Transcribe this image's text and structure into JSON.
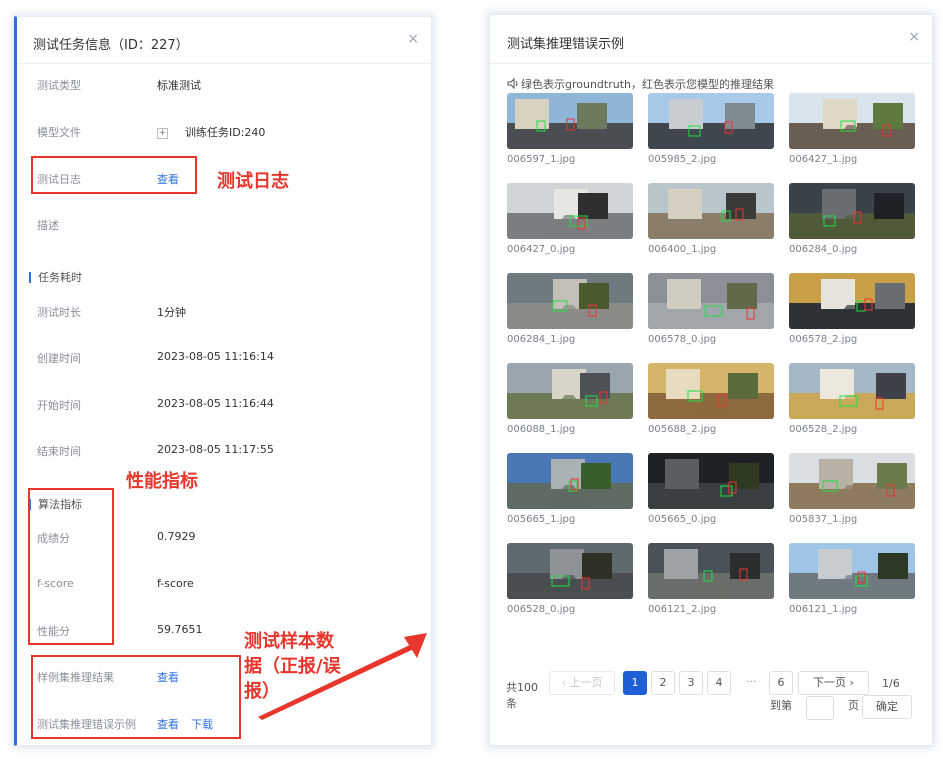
{
  "left_panel": {
    "title": "测试任务信息（ID：227）",
    "close_icon": "×",
    "rows": {
      "test_type": {
        "label": "测试类型",
        "value": "标准测试"
      },
      "model_file": {
        "label": "模型文件",
        "value": "训练任务ID:240"
      },
      "test_log": {
        "label": "测试日志",
        "link": "查看"
      },
      "description": {
        "label": "描述"
      }
    },
    "section_time": "任务耗时",
    "time_rows": {
      "duration": {
        "label": "测试时长",
        "value": "1分钟"
      },
      "created": {
        "label": "创建时间",
        "value": "2023-08-05 11:16:14"
      },
      "started": {
        "label": "开始时间",
        "value": "2023-08-05 11:16:44"
      },
      "ended": {
        "label": "结束时间",
        "value": "2023-08-05 11:17:55"
      }
    },
    "section_metrics": "算法指标",
    "metric_rows": {
      "score": {
        "label": "成绩分",
        "value": "0.7929"
      },
      "fscore": {
        "label": "f-score",
        "value": "f-score"
      },
      "perf": {
        "label": "性能分",
        "value": "59.7651"
      }
    },
    "bottom_rows": {
      "sample_result": {
        "label": "样例集推理结果",
        "link": "查看"
      },
      "error_examples": {
        "label": "测试集推理错误示例",
        "link": "查看",
        "link2": "下载"
      }
    }
  },
  "annotations": {
    "test_log": "测试日志",
    "metrics": "性能指标",
    "samples_line1": "测试样本数",
    "samples_line2": "据（正报/误",
    "samples_line3": "报）",
    "color": "#e8362c"
  },
  "right_panel": {
    "title": "测试集推理错误示例",
    "close_icon": "×",
    "hint": "绿色表示groundtruth，红色表示您模型的推理结果",
    "speaker_icon": "speaker-icon",
    "images": [
      "006597_1.jpg",
      "005985_2.jpg",
      "006427_1.jpg",
      "006427_0.jpg",
      "006400_1.jpg",
      "006284_0.jpg",
      "006284_1.jpg",
      "006578_0.jpg",
      "006578_2.jpg",
      "006088_1.jpg",
      "005688_2.jpg",
      "006528_2.jpg",
      "005665_1.jpg",
      "005665_0.jpg",
      "005837_1.jpg",
      "006528_0.jpg",
      "006121_2.jpg",
      "006121_1.jpg"
    ],
    "pagination": {
      "total_line1": "共100",
      "total_line2": "条",
      "prev": "上一页",
      "pages": [
        "1",
        "2",
        "3",
        "4"
      ],
      "ellipsis": "···",
      "last_page": "6",
      "next": "下一页",
      "page_info": "1/6",
      "goto": "到第",
      "goto_unit": "页",
      "goto_value": "",
      "confirm": "确定"
    }
  },
  "colors": {
    "accent": "#1e5fd6",
    "annotation": "#e8362c"
  }
}
